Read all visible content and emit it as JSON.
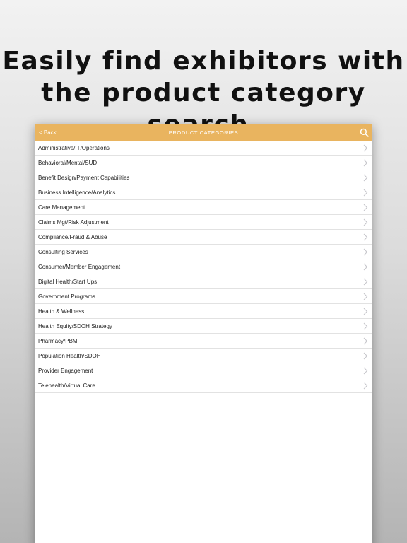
{
  "headline": {
    "line1": "Easily find exhibitors with",
    "line2": "the product category search."
  },
  "navbar": {
    "back_label": "< Back",
    "title": "PRODUCT CATEGORIES",
    "search_icon": "search-icon",
    "color": "#e9b45f"
  },
  "categories": [
    "Administrative/IT/Operations",
    "Behavioral/Mental/SUD",
    "Benefit Design/Payment Capabilities",
    "Business Intelligence/Analytics",
    "Care Management",
    "Claims Mgt/Risk Adjustment",
    "Compliance/Fraud & Abuse",
    "Consulting Services",
    "Consumer/Member Engagement",
    "Digital Health/Start Ups",
    "Government Programs",
    "Health & Wellness",
    "Health Equity/SDOH Strategy",
    "Pharmacy/PBM",
    "Population Health/SDOH",
    "Provider Engagement",
    "Telehealth/Virtual Care"
  ],
  "tabbar": {
    "icons": [
      "home-icon",
      "schedule-icon",
      "exhibitors-icon",
      "speakers-icon",
      "more-icon"
    ],
    "active_color": "#c9473b"
  }
}
